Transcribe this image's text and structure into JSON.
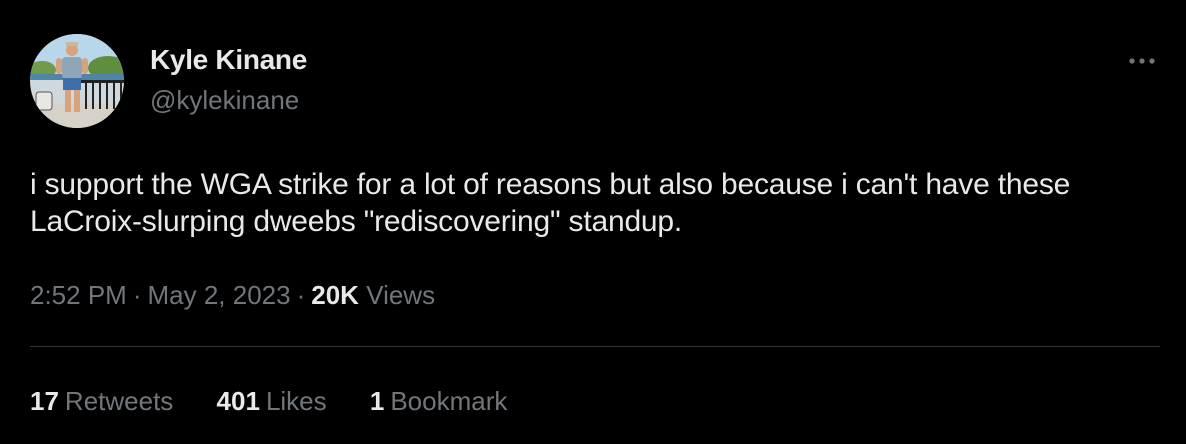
{
  "author": {
    "display_name": "Kyle Kinane",
    "handle": "@kylekinane"
  },
  "more_icon": "more-horizontal-icon",
  "tweet": {
    "text": "i support the WGA strike for a lot of reasons but also because i can't have these LaCroix-slurping dweebs \"rediscovering\" standup."
  },
  "meta": {
    "time": "2:52 PM",
    "separator": "·",
    "date": "May 2, 2023",
    "views_count": "20K",
    "views_label": "Views"
  },
  "stats": {
    "retweets_count": "17",
    "retweets_label": "Retweets",
    "likes_count": "401",
    "likes_label": "Likes",
    "bookmarks_count": "1",
    "bookmarks_label": "Bookmark"
  },
  "colors": {
    "background": "#000000",
    "primary_text": "#e7e9ea",
    "secondary_text": "#71767b",
    "divider": "#2f3336"
  }
}
